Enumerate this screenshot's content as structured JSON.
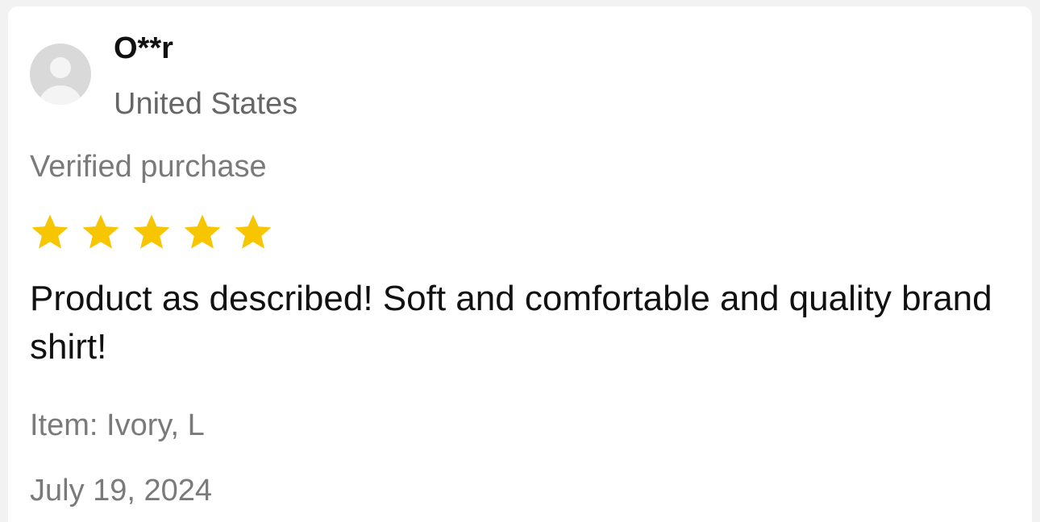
{
  "review": {
    "user_name": "O**r",
    "country": "United States",
    "verified_label": "Verified purchase",
    "rating": 5,
    "rating_max": 5,
    "text": "Product as described! Soft and comfortable and quality brand shirt!",
    "item": "Item: Ivory, L",
    "date": "July 19, 2024"
  },
  "icons": {
    "avatar": "user-avatar-icon",
    "star": "star-icon"
  },
  "colors": {
    "star": "#f7c600",
    "avatar_bg": "#d9d9d9",
    "secondary_text": "#7a7a7a"
  }
}
